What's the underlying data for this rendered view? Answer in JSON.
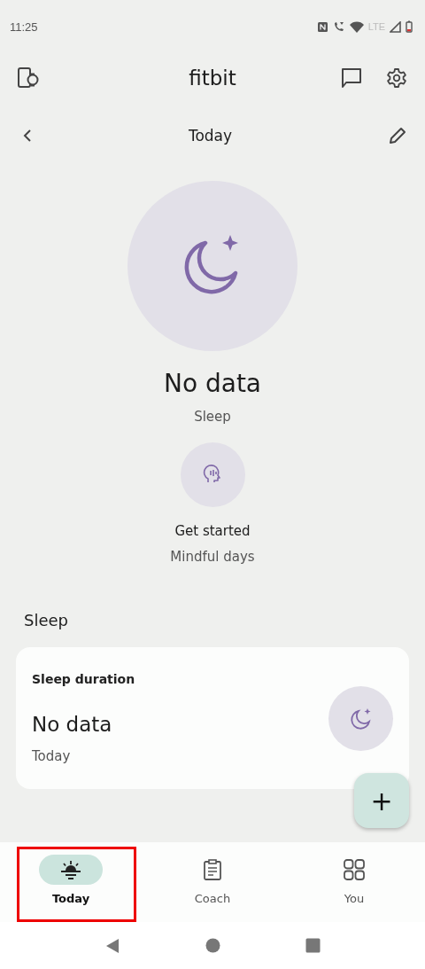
{
  "status_bar": {
    "time": "11:25",
    "network": "LTE"
  },
  "app_bar": {
    "title": "fitbit"
  },
  "date_bar": {
    "label": "Today"
  },
  "hero": {
    "value": "No data",
    "label": "Sleep"
  },
  "mindful": {
    "action": "Get started",
    "label": "Mindful days"
  },
  "section": {
    "title": "Sleep"
  },
  "card": {
    "title": "Sleep duration",
    "value": "No data",
    "period": "Today"
  },
  "fab": {
    "label": "+"
  },
  "tabs": [
    {
      "label": "Today",
      "selected": true,
      "highlighted": true
    },
    {
      "label": "Coach",
      "selected": false,
      "highlighted": false
    },
    {
      "label": "You",
      "selected": false,
      "highlighted": false
    }
  ]
}
